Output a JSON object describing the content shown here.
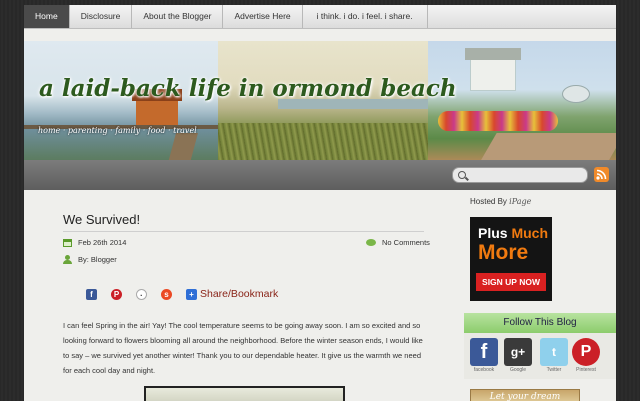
{
  "nav": {
    "items": [
      {
        "label": "Home",
        "active": true
      },
      {
        "label": "Disclosure"
      },
      {
        "label": "About the Blogger"
      },
      {
        "label": "Advertise Here"
      },
      {
        "label": "i think. i do. i feel. i share."
      }
    ]
  },
  "header": {
    "title": "a laid-back life in ormond beach",
    "tagline": "home · parenting · family · food · travel"
  },
  "search": {
    "placeholder": ""
  },
  "post": {
    "title": "We Survived!",
    "date": "Feb 26th 2014",
    "author": "By: Blogger",
    "comments": "No Comments",
    "share_label": "Share/Bookmark",
    "body": "I can feel Spring in the air! Yay! The cool temperature seems to be going away soon. I am so excited and so looking forward to flowers blooming all around the neighborhood. Before the winter season ends, I would like to say – we survived yet another winter! Thank you to our dependable heater. It give us the warmth we need for each cool day and night."
  },
  "sidebar": {
    "hosted_by": "Hosted By",
    "hosted_brand": "iPage",
    "ad": {
      "line1": "Plus",
      "line1b": "Much",
      "line2": "More",
      "button": "SIGN UP NOW"
    },
    "follow_title": "Follow This Blog",
    "follow": [
      {
        "label": "facebook"
      },
      {
        "label": "Google"
      },
      {
        "label": "Twitter"
      },
      {
        "label": "Pinterest"
      }
    ],
    "bottom_banner": "Let your dream"
  },
  "colors": {
    "accent": "#f08a2a",
    "title_green": "#2d5a1e",
    "follow_green": "#8ccc6c"
  }
}
